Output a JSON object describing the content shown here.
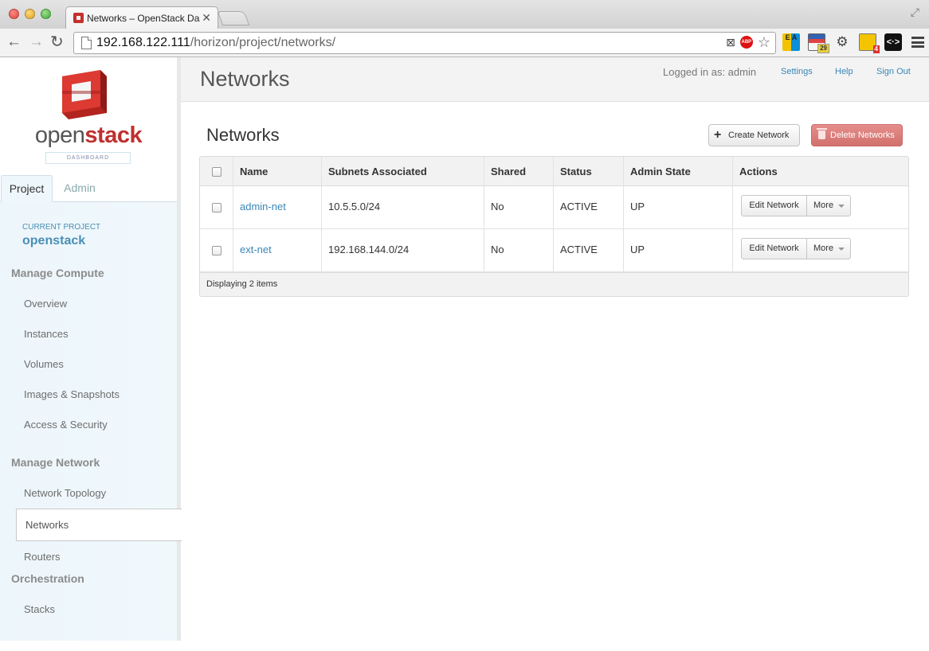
{
  "browser": {
    "tab_title": "Networks – OpenStack Das",
    "tab_close": "✕",
    "url_host": "192.168.122.111",
    "url_path": "/horizon/project/networks/",
    "abp_label": "ABP",
    "ext_ea_label": "E A",
    "calendar_badge": "29",
    "folder_badge": "4",
    "code_ext_label": "<·>"
  },
  "sidebar": {
    "logo_text_light": "open",
    "logo_text_bold": "stack",
    "logo_sub": "DASHBOARD",
    "tabs": [
      {
        "label": "Project"
      },
      {
        "label": "Admin"
      }
    ],
    "current_project_label": "CURRENT PROJECT",
    "current_project_name": "openstack",
    "sections": [
      {
        "title": "Manage Compute",
        "items": [
          "Overview",
          "Instances",
          "Volumes",
          "Images & Snapshots",
          "Access & Security"
        ]
      },
      {
        "title": "Manage Network",
        "items": [
          "Network Topology",
          "Networks",
          "Routers"
        ]
      },
      {
        "title": "Orchestration",
        "items": [
          "Stacks"
        ]
      }
    ]
  },
  "header": {
    "title": "Networks",
    "logged_in": "Logged in as: admin",
    "links": [
      "Settings",
      "Help",
      "Sign Out"
    ]
  },
  "main": {
    "title": "Networks",
    "create_button": "Create Network",
    "delete_button": "Delete Networks",
    "columns": [
      "Name",
      "Subnets Associated",
      "Shared",
      "Status",
      "Admin State",
      "Actions"
    ],
    "rows": [
      {
        "name": "admin-net",
        "subnets": "10.5.5.0/24",
        "shared": "No",
        "status": "ACTIVE",
        "admin_state": "UP",
        "edit": "Edit Network",
        "more": "More"
      },
      {
        "name": "ext-net",
        "subnets": "192.168.144.0/24",
        "shared": "No",
        "status": "ACTIVE",
        "admin_state": "UP",
        "edit": "Edit Network",
        "more": "More"
      }
    ],
    "footer": "Displaying 2 items"
  },
  "colors": {
    "brand_red": "#c02f2f",
    "link_blue": "#3a86b5",
    "danger": "#d2706d"
  }
}
